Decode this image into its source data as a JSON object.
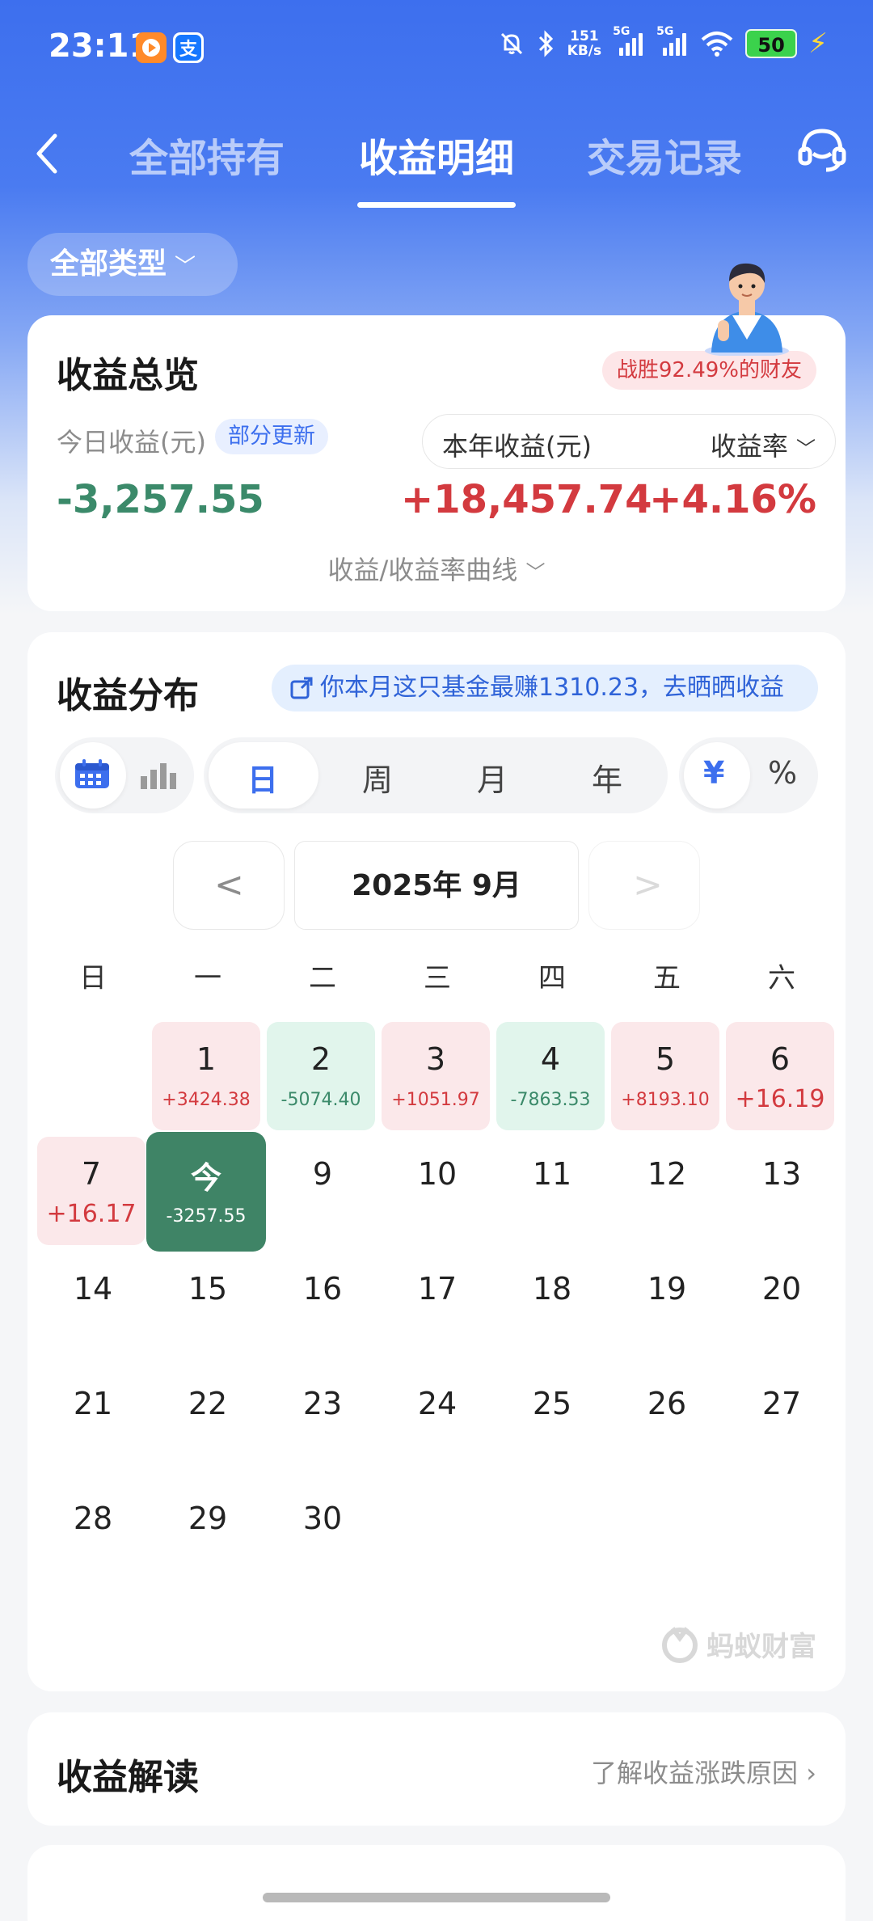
{
  "status_bar": {
    "time": "23:11",
    "net_speed_value": "151",
    "net_speed_unit": "KB/s",
    "signal_label_1": "5G",
    "signal_label_2": "5G",
    "battery": "50"
  },
  "nav": {
    "tabs": [
      "全部持有",
      "收益明细",
      "交易记录"
    ],
    "active_tab": "收益明细"
  },
  "filter": {
    "label": "全部类型"
  },
  "overview": {
    "title": "收益总览",
    "rank_badge": "战胜92.49%的财友",
    "today_label": "今日收益(元)",
    "partial_tag": "部分更新",
    "today_value": "-3,257.55",
    "year_label": "本年收益(元)",
    "rate_label": "收益率",
    "year_value": "+18,457.74",
    "rate_value": "+4.16%",
    "curve_toggle": "收益/收益率曲线"
  },
  "distribution": {
    "title": "收益分布",
    "promo": "你本月这只基金最赚1310.23，去晒晒收益",
    "period_tabs": [
      "日",
      "周",
      "月",
      "年"
    ],
    "active_period": "日",
    "unit_tabs": [
      "¥",
      "%"
    ],
    "month": "2025年 9月",
    "weekdays": [
      "日",
      "一",
      "二",
      "三",
      "四",
      "五",
      "六"
    ],
    "days": [
      {
        "d": "1",
        "v": "+3424.38",
        "kind": "pos"
      },
      {
        "d": "2",
        "v": "-5074.40",
        "kind": "neg"
      },
      {
        "d": "3",
        "v": "+1051.97",
        "kind": "pos"
      },
      {
        "d": "4",
        "v": "-7863.53",
        "kind": "neg"
      },
      {
        "d": "5",
        "v": "+8193.10",
        "kind": "pos"
      },
      {
        "d": "6",
        "v": "+16.19",
        "kind": "pos"
      },
      {
        "d": "7",
        "v": "+16.17",
        "kind": "pos"
      },
      {
        "d": "今",
        "v": "-3257.55",
        "kind": "today"
      }
    ],
    "plain_days": [
      "9",
      "10",
      "11",
      "12",
      "13",
      "14",
      "15",
      "16",
      "17",
      "18",
      "19",
      "20",
      "21",
      "22",
      "23",
      "24",
      "25",
      "26",
      "27",
      "28",
      "29",
      "30"
    ],
    "brand": "蚂蚁财富"
  },
  "interpret": {
    "title": "收益解读",
    "link": "了解收益涨跌原因"
  },
  "colors": {
    "accent_blue": "#3d6fee",
    "gain_red": "#d33a3f",
    "loss_green": "#3b8a6a",
    "today_green": "#3f8466"
  }
}
